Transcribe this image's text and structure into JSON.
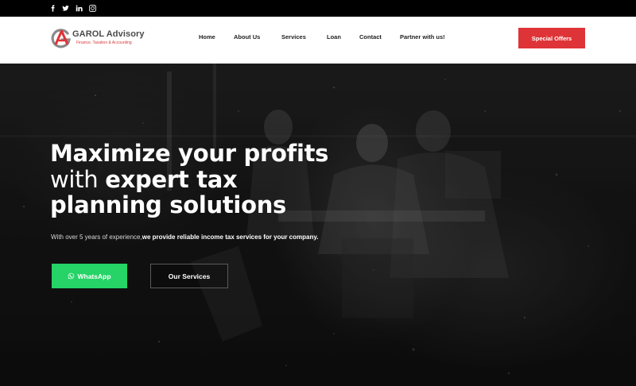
{
  "topbar": {
    "social": [
      "facebook-icon",
      "twitter-icon",
      "linkedin-icon",
      "instagram-icon"
    ]
  },
  "header": {
    "logo_title": "GAROL Advisory",
    "logo_subtitle": "Finance, Taxation & Accounting",
    "nav": [
      {
        "label": "Home"
      },
      {
        "label": "About Us"
      },
      {
        "label": "Services"
      },
      {
        "label": "Loan"
      },
      {
        "label": "Contact"
      },
      {
        "label": "Partner with us!"
      }
    ],
    "cta_label": "Special Offers"
  },
  "hero": {
    "line1": "Maximize your profits",
    "line2_light": "with ",
    "line2_bold": "expert tax",
    "line3": "planning solutions",
    "lead_normal": "With over 5 years of experience,",
    "lead_bold": "we provide reliable income tax services for your company.",
    "whatsapp_label": "WhatsApp",
    "services_label": "Our Services"
  },
  "colors": {
    "accent_red": "#df3437",
    "whatsapp_green": "#25d366",
    "topbar": "#000000"
  }
}
